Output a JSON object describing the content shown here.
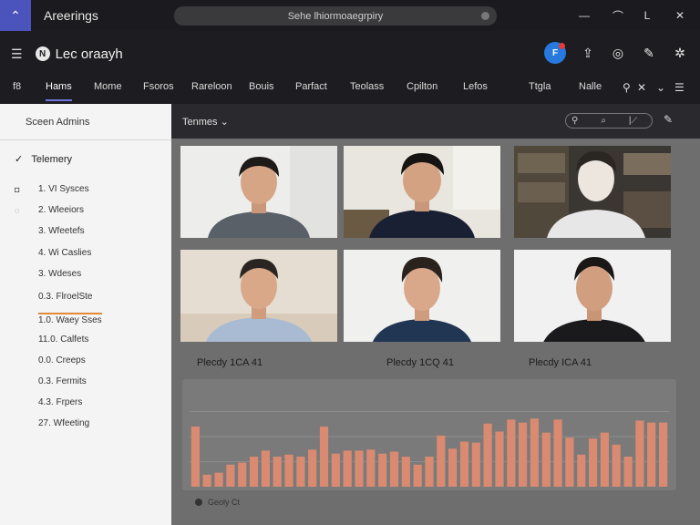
{
  "window": {
    "title": "Areerings",
    "search_placeholder": "Sehe lhiormoaegrpiry",
    "minimize": "—",
    "restore": "L",
    "close": "✕",
    "grid": "⌃"
  },
  "appbar": {
    "workspace_logo": "N",
    "workspace_name": "Lec oraayh",
    "avatar": "F"
  },
  "tabs": [
    {
      "label": "f8"
    },
    {
      "label": "Hams"
    },
    {
      "label": "Mome"
    },
    {
      "label": "Fsoros"
    },
    {
      "label": "Rareloon"
    },
    {
      "label": "Bouis"
    },
    {
      "label": "Parfact"
    },
    {
      "label": "Teolass"
    },
    {
      "label": "Cpilton"
    },
    {
      "label": "Lefos"
    },
    {
      "label": "Ttgla"
    },
    {
      "label": "Nalle"
    }
  ],
  "sidebar": {
    "header": "Sceen Admins",
    "group": "Telemery",
    "items": [
      {
        "label": "1. VI Sysces"
      },
      {
        "label": "2. Wleeiors"
      },
      {
        "label": "3. Wfeetefs"
      },
      {
        "label": "4. Wi Caslies"
      },
      {
        "label": "3. Wdeses"
      },
      {
        "label": "0.3. FlroelSte"
      },
      {
        "label": "1.0. Waey Sses"
      },
      {
        "label": "11.0. Calfets"
      },
      {
        "label": "0.0. Creeps"
      },
      {
        "label": "0.3. Fermits"
      },
      {
        "label": "4.3. Frpers"
      },
      {
        "label": "27. Wfeeting"
      }
    ]
  },
  "main": {
    "title": "Tenmes",
    "filter_placeholder": "",
    "captions": [
      "Plecdy 1CA 41",
      "Plecdy 1CQ 41",
      "Plecdy ICA 41"
    ],
    "legend": "Geoly Ct"
  },
  "colors": {
    "accent": "#6e74d9",
    "bar": "#d98a70",
    "avatar": "#2779e0"
  },
  "chart_data": {
    "type": "bar",
    "series": [
      {
        "values": [
          60,
          12,
          14,
          22,
          24,
          30,
          36,
          30,
          32,
          30,
          37,
          60,
          33,
          36,
          36,
          37,
          33,
          35,
          30,
          22,
          30,
          51,
          38,
          45,
          44,
          63,
          55,
          67,
          64,
          68,
          54,
          67,
          49,
          32,
          48,
          54,
          42,
          30,
          66,
          64,
          64
        ]
      }
    ],
    "ylim": [
      0,
      100
    ],
    "grid": true
  }
}
